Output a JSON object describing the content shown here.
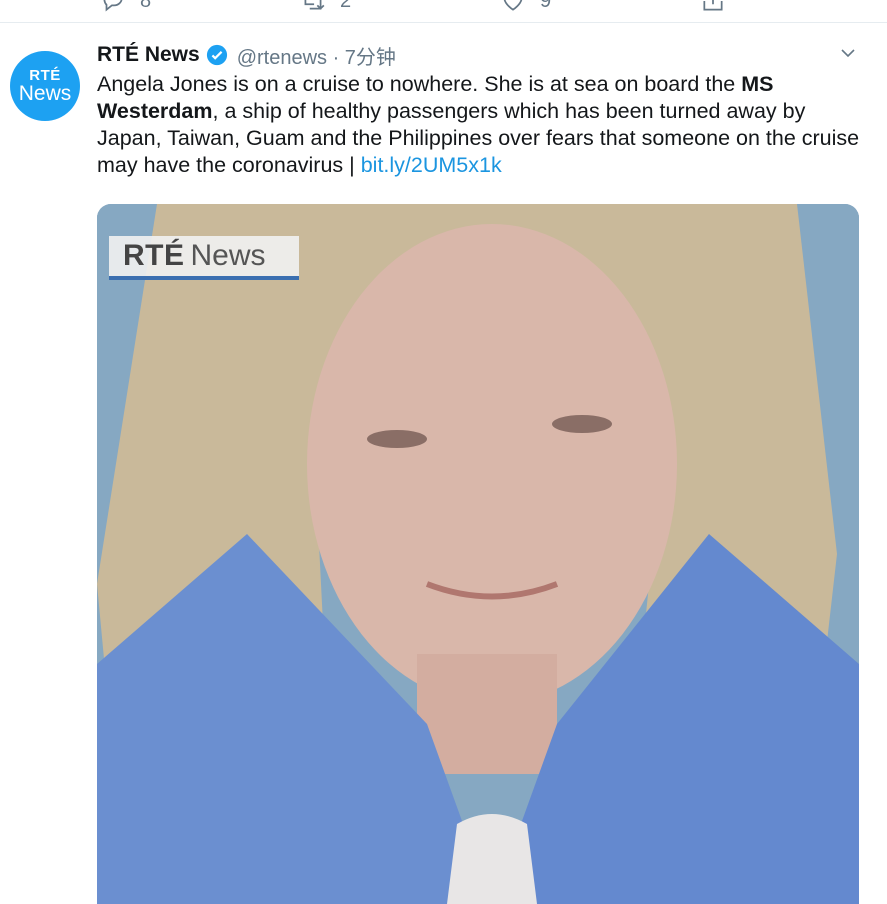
{
  "actions": {
    "reply_count": "8",
    "retweet_count": "2",
    "like_count": "9"
  },
  "tweet": {
    "avatar": {
      "line1": "RTÉ",
      "line2": "News"
    },
    "author_name": "RTÉ News",
    "handle_time": "@rtenews · 7分钟",
    "text_part1": "Angela Jones is on a cruise to nowhere. She is at sea on board the ",
    "text_bold": "MS Westerdam",
    "text_part2": ", a ship of healthy passengers which has been turned away by Japan, Taiwan, Guam and the Philippines over fears that someone on the cruise may have the coronavirus | ",
    "link": "bit.ly/2UM5x1k",
    "media_overlay": {
      "brand": "RTÉ",
      "word": "News"
    }
  },
  "colors": {
    "accent": "#1da1f2",
    "link": "#1b95e0",
    "muted": "#657786",
    "text": "#14171a"
  },
  "icons": [
    "reply-icon",
    "retweet-icon",
    "like-icon",
    "share-icon",
    "verified-icon",
    "chevron-down-icon"
  ]
}
